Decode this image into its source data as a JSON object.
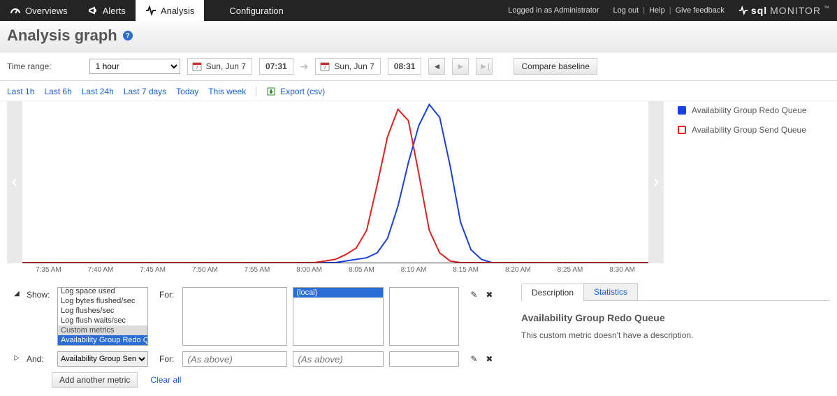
{
  "nav": {
    "tabs": [
      {
        "label": "Overviews",
        "icon": "gauge"
      },
      {
        "label": "Alerts",
        "icon": "megaphone"
      },
      {
        "label": "Analysis",
        "icon": "pulse"
      },
      {
        "label": "Configuration",
        "icon": "wrench"
      }
    ],
    "logged_in": "Logged in as Administrator",
    "logout": "Log out",
    "help": "Help",
    "feedback": "Give feedback",
    "brand_bold": "sql",
    "brand_thin": "MONITOR",
    "tm": "™"
  },
  "page_title": "Analysis graph",
  "timebar": {
    "label": "Time range:",
    "range": "1 hour",
    "from_date": "Sun, Jun 7",
    "from_time": "07:31",
    "to_date": "Sun, Jun 7",
    "to_time": "08:31",
    "compare": "Compare baseline"
  },
  "quicklinks": {
    "last1h": "Last 1h",
    "last6h": "Last 6h",
    "last24h": "Last 24h",
    "last7d": "Last 7 days",
    "today": "Today",
    "thisweek": "This week",
    "export": "Export (csv)"
  },
  "chart_data": {
    "type": "line",
    "xlabel": "",
    "ylabel": "",
    "x_ticks": [
      "7:35 AM",
      "7:40 AM",
      "7:45 AM",
      "7:50 AM",
      "7:55 AM",
      "8:00 AM",
      "8:05 AM",
      "8:10 AM",
      "8:15 AM",
      "8:20 AM",
      "8:25 AM",
      "8:30 AM"
    ],
    "ylim": [
      0,
      100
    ],
    "series": [
      {
        "name": "Availability Group Redo Queue",
        "color": "#1a3fe0",
        "style": "filled",
        "points": [
          [
            0,
            0
          ],
          [
            30,
            0
          ],
          [
            33,
            3
          ],
          [
            34,
            6
          ],
          [
            35,
            15
          ],
          [
            36,
            35
          ],
          [
            37,
            62
          ],
          [
            38,
            85
          ],
          [
            39,
            98
          ],
          [
            40,
            90
          ],
          [
            41,
            60
          ],
          [
            42,
            25
          ],
          [
            43,
            8
          ],
          [
            44,
            2
          ],
          [
            45,
            0
          ],
          [
            60,
            0
          ]
        ]
      },
      {
        "name": "Availability Group Send Queue",
        "color": "#e02020",
        "style": "hollow",
        "points": [
          [
            0,
            0
          ],
          [
            28,
            0
          ],
          [
            30,
            2
          ],
          [
            31,
            5
          ],
          [
            32,
            9
          ],
          [
            33,
            20
          ],
          [
            34,
            48
          ],
          [
            35,
            78
          ],
          [
            36,
            95
          ],
          [
            37,
            88
          ],
          [
            38,
            55
          ],
          [
            39,
            20
          ],
          [
            40,
            6
          ],
          [
            41,
            1
          ],
          [
            42,
            0
          ],
          [
            60,
            0
          ]
        ]
      }
    ]
  },
  "legend": [
    {
      "label": "Availability Group Redo Queue",
      "swatch": "filled"
    },
    {
      "label": "Availability Group Send Queue",
      "swatch": "hollow"
    }
  ],
  "show_row": {
    "label": "Show:",
    "for": "For:",
    "metrics": [
      {
        "text": "Log space used"
      },
      {
        "text": "Log bytes flushed/sec"
      },
      {
        "text": "Log flushes/sec"
      },
      {
        "text": "Log flush waits/sec"
      },
      {
        "text": "Custom metrics",
        "heading": true
      },
      {
        "text": "Availability Group Redo Queue",
        "selected": true
      }
    ],
    "local_item": "(local)"
  },
  "and_row": {
    "label": "And:",
    "for": "For:",
    "metric": "Availability Group Send Queue",
    "placeholder": "(As above)"
  },
  "footer": {
    "add": "Add another metric",
    "clear": "Clear all"
  },
  "rightpanel": {
    "tab_desc": "Description",
    "tab_stats": "Statistics",
    "title": "Availability Group Redo Queue",
    "body": "This custom metric doesn't have a description."
  }
}
